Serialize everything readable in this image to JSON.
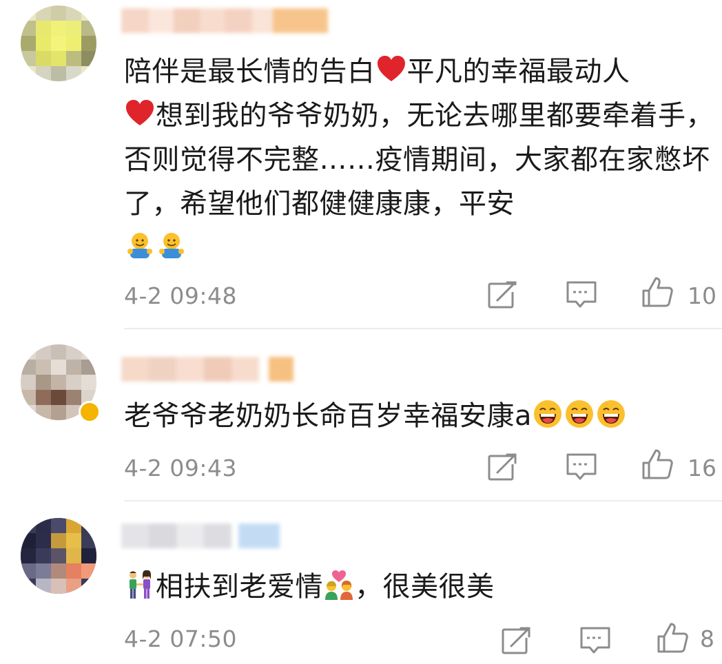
{
  "comments": [
    {
      "text_parts": [
        "陪伴是最长情的告白",
        "平凡的幸福最动人",
        "想到我的爷爷奶奶，无论去哪里都要牵着手，否则觉得不完整……疫情期间，大家都在家憋坏了，希望他们都健健康康，平安"
      ],
      "timestamp": "4-2 09:48",
      "likes": "10"
    },
    {
      "text": "老爷爷老奶奶长命百岁幸福安康a",
      "timestamp": "4-2 09:43",
      "likes": "16"
    },
    {
      "text_parts": [
        "相扶到老爱情",
        "，很美很美"
      ],
      "timestamp": "4-2 07:50",
      "likes": "8"
    }
  ],
  "icons": {
    "share": "share-icon",
    "reply": "comment-icon",
    "like": "thumbs-up-icon",
    "heart": "red-heart-emoji",
    "hug": "hug-emoji",
    "laugh": "laughing-emoji",
    "couple": "couple-holding-hands-emoji",
    "kiss": "couple-with-heart-emoji"
  },
  "colors": {
    "text": "#1a1a1a",
    "meta": "#8c8c8c",
    "divider": "#ececec",
    "heart": "#e0242b",
    "emoji_yellow": "#fbc02d"
  }
}
